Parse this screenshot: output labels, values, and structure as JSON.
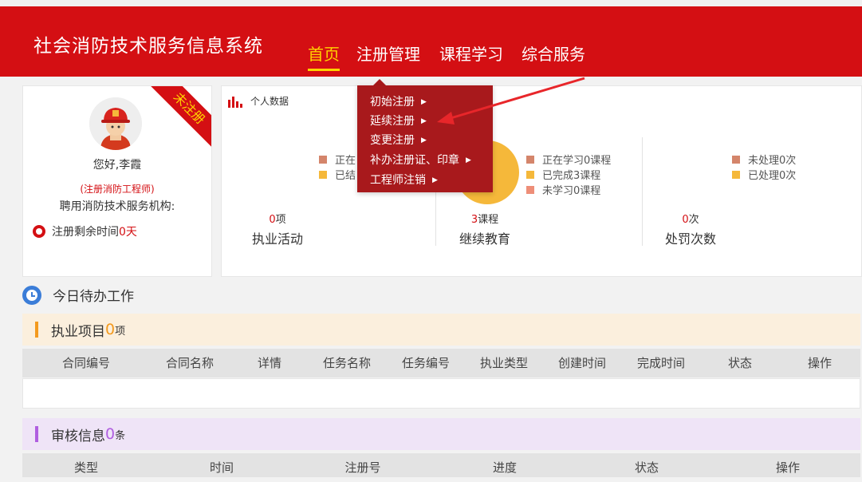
{
  "header": {
    "title": "社会消防技术服务信息系统",
    "nav": [
      "首页",
      "注册管理",
      "课程学习",
      "综合服务"
    ],
    "active_nav": "首页"
  },
  "profile": {
    "ribbon": "未注册",
    "greeting": "您好,李霞",
    "role": "(注册消防工程师)",
    "org_label": "聘用消防技术服务机构:",
    "remaining_label": "注册剩余时间",
    "remaining_value": "0天"
  },
  "stats": {
    "title": "个人数据",
    "practice": {
      "legend": [
        "正在",
        "已结"
      ],
      "count_num": "0",
      "count_unit": "项",
      "label": "执业活动"
    },
    "education": {
      "legend": [
        "正在学习0课程",
        "已完成3课程",
        "未学习0课程"
      ],
      "count_num": "3",
      "count_unit": "课程",
      "label": "继续教育"
    },
    "penalty": {
      "legend": [
        "未处理0次",
        "已处理0次"
      ],
      "count_num": "0",
      "count_unit": "次",
      "label": "处罚次数"
    }
  },
  "dropdown": {
    "items": [
      "初始注册",
      "延续注册",
      "变更注册",
      "补办注册证、印章",
      "工程师注销"
    ]
  },
  "todo": {
    "title": "今日待办工作"
  },
  "practice_projects": {
    "label": "执业项目",
    "count": "0",
    "unit": "项",
    "columns": [
      "合同编号",
      "合同名称",
      "详情",
      "任务名称",
      "任务编号",
      "执业类型",
      "创建时间",
      "完成时间",
      "状态",
      "操作"
    ]
  },
  "review_info": {
    "label": "审核信息",
    "count": "0",
    "unit": "条",
    "columns": [
      "类型",
      "时间",
      "注册号",
      "进度",
      "状态",
      "操作"
    ]
  },
  "colors": {
    "header_red": "#d40f13",
    "nav_active": "#ffd200",
    "dropdown_bg": "#a8191c",
    "legend_brown": "#d4856b",
    "legend_yellow": "#f5b83a",
    "legend_salmon": "#ee8e78",
    "orange_accent": "#f39a1e",
    "purple_accent": "#b05ee0",
    "practice_bg": "#fbefdd",
    "review_bg": "#efe4f7",
    "annotation_arrow": "#e8262a"
  }
}
